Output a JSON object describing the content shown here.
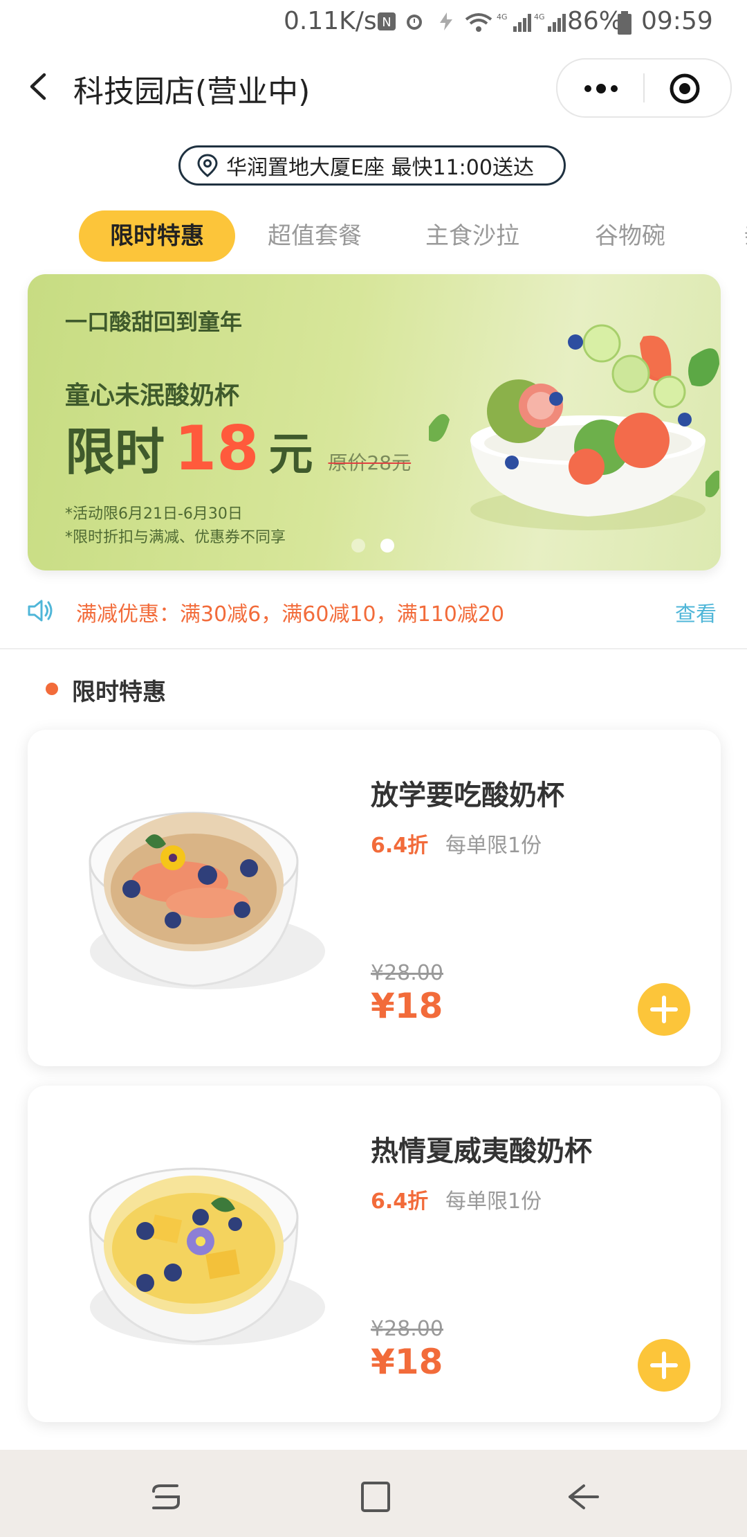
{
  "status_bar": {
    "network_speed": "0.11K/s",
    "battery": "86%",
    "time": "09:59",
    "icons": [
      "nfc-icon",
      "alarm-icon",
      "charging-icon",
      "wifi-icon",
      "signal-4g-icon",
      "signal-4g-icon",
      "battery-icon"
    ]
  },
  "header": {
    "title": "科技园店(营业中)",
    "back_icon": "chevron-left-icon",
    "more_icon": "more-dots-icon",
    "record_icon": "target-icon"
  },
  "address": {
    "text": "华润置地大厦E座 最快11:00送达",
    "icon": "location-pin-icon"
  },
  "tabs": {
    "items": [
      {
        "label": "限时特惠",
        "active": true
      },
      {
        "label": "超值套餐",
        "active": false
      },
      {
        "label": "主食沙拉",
        "active": false
      },
      {
        "label": "谷物碗",
        "active": false
      },
      {
        "label": "亲",
        "active": false
      }
    ]
  },
  "banner": {
    "slogan": "一口酸甜回到童年",
    "product": "童心未泯酸奶杯",
    "price_prefix": "限时",
    "price_number": "18",
    "price_unit": "元",
    "original_price": "原价28元",
    "note1": "*活动限6月21日-6月30日",
    "note2": "*限时折扣与满减、优惠券不同享",
    "page_indicator": {
      "count": 2,
      "active": 2
    }
  },
  "promo": {
    "icon": "speaker-icon",
    "text": "满减优惠：满30减6，满60减10，满110减20",
    "link": "查看"
  },
  "section": {
    "title": "限时特惠"
  },
  "products": [
    {
      "name": "放学要吃酸奶杯",
      "discount": "6.4折",
      "limit": "每单限1份",
      "original_price": "¥28.00",
      "price": "¥18"
    },
    {
      "name": "热情夏威夷酸奶杯",
      "discount": "6.4折",
      "limit": "每单限1份",
      "original_price": "¥28.00",
      "price": "¥18"
    }
  ],
  "colors": {
    "accent_yellow": "#fcc53a",
    "accent_orange": "#f26b3a",
    "link_blue": "#4fb6d8",
    "banner_green": "#c7dc82"
  },
  "navbar": {
    "icons": [
      "recent-apps-icon",
      "home-icon",
      "back-icon"
    ]
  }
}
